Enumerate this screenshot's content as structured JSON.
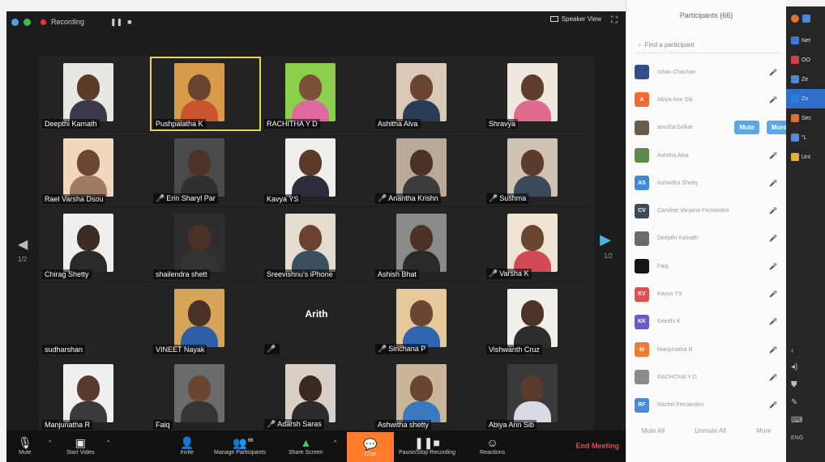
{
  "topbar": {
    "recording": "Recording",
    "speaker_view": "Speaker View"
  },
  "tiles": [
    {
      "name": "Deepthi Kamath",
      "muted": false,
      "skin": "#5b3b27",
      "shirt": "#3a3a4a",
      "bg": "#e9e7e2"
    },
    {
      "name": "Pushpalatha K",
      "muted": false,
      "skin": "#6a4330",
      "shirt": "#c8552d",
      "bg": "#d89b4c",
      "active": true
    },
    {
      "name": "RACHITHA Y D",
      "muted": false,
      "skin": "#7a5038",
      "shirt": "#e06aa0",
      "bg": "#8ad04a"
    },
    {
      "name": "Ashitha Alva",
      "muted": false,
      "skin": "#6b4433",
      "shirt": "#2b3d55",
      "bg": "#d9c9b6"
    },
    {
      "name": "Shravya",
      "muted": false,
      "skin": "#5f3d2c",
      "shirt": "#e06b8f",
      "bg": "#efe8de"
    },
    {
      "name": "Rael Varsha Dsou",
      "muted": false,
      "skin": "#6a4633",
      "shirt": "#a07a62",
      "bg": "#f1d7bc"
    },
    {
      "name": "Erin Sharyl Par",
      "muted": true,
      "skin": "#4c3327",
      "shirt": "#303030",
      "bg": "#4a4a4a"
    },
    {
      "name": "Kavya YS",
      "muted": false,
      "skin": "#5a3b2b",
      "shirt": "#2e2e3a",
      "bg": "#f0efec"
    },
    {
      "name": "Anantha Krishn",
      "muted": true,
      "skin": "#4b3226",
      "shirt": "#3c3c3c",
      "bg": "#b9aa98"
    },
    {
      "name": "Sushma",
      "muted": true,
      "skin": "#5a3b2c",
      "shirt": "#3a4a5a",
      "bg": "#cfc3b4"
    },
    {
      "name": "Chirag Shetty",
      "muted": false,
      "skin": "#3c2b22",
      "shirt": "#2a2a2a",
      "bg": "#eeeeec"
    },
    {
      "name": "shailendra shett",
      "muted": false,
      "skin": "#4a3226",
      "shirt": "#333333",
      "bg": "#2e2e2e"
    },
    {
      "name": "Sreevishnu's iPhone",
      "muted": false,
      "skin": "#6a4330",
      "shirt": "#3a5060",
      "bg": "#e4dccf"
    },
    {
      "name": "Ashish Bhat",
      "muted": false,
      "skin": "#4a3226",
      "shirt": "#2a2a2a",
      "bg": "#8a8a88"
    },
    {
      "name": "Varsha K",
      "muted": true,
      "skin": "#6a4532",
      "shirt": "#d14a55",
      "bg": "#efe4d2"
    },
    {
      "name": "sudharshan",
      "muted": false,
      "skin": "#1f1f1f",
      "shirt": "#1f1f1f",
      "bg": "#1f1f1f",
      "empty": true
    },
    {
      "name": "VINEET Nayak",
      "muted": false,
      "skin": "#4a3226",
      "shirt": "#2f5ea8",
      "bg": "#d6a55a"
    },
    {
      "name": "",
      "muted": true,
      "center": "Arith",
      "skin": "#1f1f1f",
      "shirt": "#1f1f1f",
      "bg": "#1f1f1f",
      "empty": true
    },
    {
      "name": "Sinchana P",
      "muted": true,
      "skin": "#6a4532",
      "shirt": "#3066b0",
      "bg": "#e6c89a"
    },
    {
      "name": "Vishwanth Cruz",
      "muted": false,
      "skin": "#4c3328",
      "shirt": "#2d2d2d",
      "bg": "#f1efea"
    },
    {
      "name": "Manjunatha R",
      "muted": false,
      "skin": "#5a3b2b",
      "shirt": "#3a3a3a",
      "bg": "#f0efed"
    },
    {
      "name": "Faiq",
      "muted": false,
      "skin": "#6a4532",
      "shirt": "#353535",
      "bg": "#6b6b6b"
    },
    {
      "name": "Adarsh Saras",
      "muted": true,
      "skin": "#3b2a22",
      "shirt": "#2c2c2c",
      "bg": "#d8d0c6"
    },
    {
      "name": "Ashwitha shetty",
      "muted": false,
      "skin": "#6a4532",
      "shirt": "#3a78c0",
      "bg": "#c9b59a"
    },
    {
      "name": "Abiya Ann Sib",
      "muted": false,
      "skin": "#5b3c2c",
      "shirt": "#d6dbe4",
      "bg": "#3a3a3a"
    }
  ],
  "nav": {
    "page_left": "1/2",
    "page_right": "1/2"
  },
  "toolbar": {
    "mute": "Mute",
    "start_video": "Start Video",
    "invite": "Invite",
    "manage_participants": "Manage Participants",
    "participant_count": "66",
    "share_screen": "Share Screen",
    "chat": "Chat",
    "pause_recording": "Pause/Stop Recording",
    "reactions": "Reactions",
    "end_meeting": "End Meeting"
  },
  "panel": {
    "title": "Participants (66)",
    "search_placeholder": "Find a participant",
    "participants": [
      {
        "initials": "",
        "name": "Ishan Chauhan",
        "color": "#2f4e8a"
      },
      {
        "initials": "A",
        "name": "Abiya Ann Sib",
        "color": "#f06a2d"
      },
      {
        "initials": "",
        "name": "anusha bolkar",
        "color": "#6a5a4a",
        "buttons": true
      },
      {
        "initials": "",
        "name": "Ashitha Alva",
        "color": "#5f8a4a"
      },
      {
        "initials": "AS",
        "name": "Ashwitha Shetty",
        "color": "#3e8ad6"
      },
      {
        "initials": "CV",
        "name": "Caroline Vanjana Fernandes",
        "color": "#3a4a5a"
      },
      {
        "initials": "",
        "name": "Deepthi Kamath",
        "color": "#6a6a6a"
      },
      {
        "initials": "",
        "name": "Faiq",
        "color": "#151515"
      },
      {
        "initials": "KV",
        "name": "Kavya YS",
        "color": "#e05050"
      },
      {
        "initials": "KK",
        "name": "Keerthi K",
        "color": "#6a5ad0"
      },
      {
        "initials": "M",
        "name": "Manjunatha R",
        "color": "#f07a2d"
      },
      {
        "initials": "",
        "name": "RACHITHA Y D",
        "color": "#8a8a8a"
      },
      {
        "initials": "RF",
        "name": "Rachel Fernandes",
        "color": "#4a8ad6"
      }
    ],
    "mute_btn": "Mute",
    "more_btn": "More",
    "mute_all": "Mute All",
    "unmute_all": "Unmute All",
    "more": "More"
  },
  "side": {
    "items": [
      {
        "label": "Net",
        "color": "#3a7ad0"
      },
      {
        "label": "OO",
        "color": "#d04040"
      },
      {
        "label": "Ze",
        "color": "#4a8ad6"
      },
      {
        "label": "Zo",
        "color": "#2d7ce0",
        "selected": true
      },
      {
        "label": "Sec",
        "color": "#e0702d"
      },
      {
        "label": "\"L",
        "color": "#5a8ad0"
      },
      {
        "label": "Unt",
        "color": "#e0b040"
      }
    ],
    "bottom_label": "ENG"
  }
}
